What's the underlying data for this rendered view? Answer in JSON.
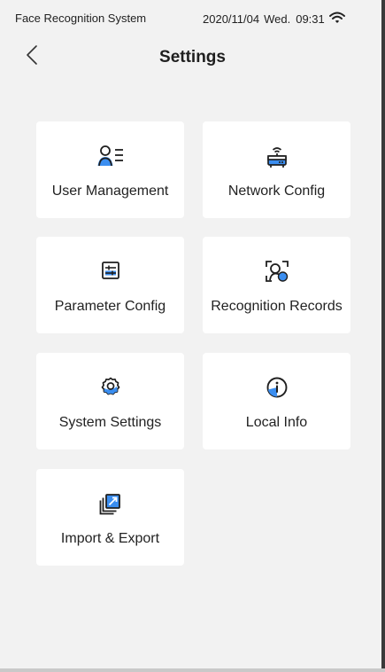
{
  "status_bar": {
    "app_name": "Face Recognition System",
    "date": "2020/11/04",
    "weekday": "Wed.",
    "time": "09:31",
    "wifi_icon": "wifi-icon"
  },
  "header": {
    "back_icon": "chevron-left-icon",
    "title": "Settings"
  },
  "menu": {
    "items": [
      {
        "label": "User Management",
        "icon": "user-list-icon"
      },
      {
        "label": "Network Config",
        "icon": "router-icon"
      },
      {
        "label": "Parameter Config",
        "icon": "sliders-icon"
      },
      {
        "label": "Recognition Records",
        "icon": "face-scan-icon"
      },
      {
        "label": "System Settings",
        "icon": "gear-icon"
      },
      {
        "label": "Local Info",
        "icon": "info-icon"
      },
      {
        "label": "Import & Export",
        "icon": "import-export-icon"
      }
    ]
  },
  "colors": {
    "accent": "#3b8ef0",
    "icon_stroke": "#1f1f1f",
    "background": "#f2f2f2",
    "tile": "#ffffff"
  }
}
